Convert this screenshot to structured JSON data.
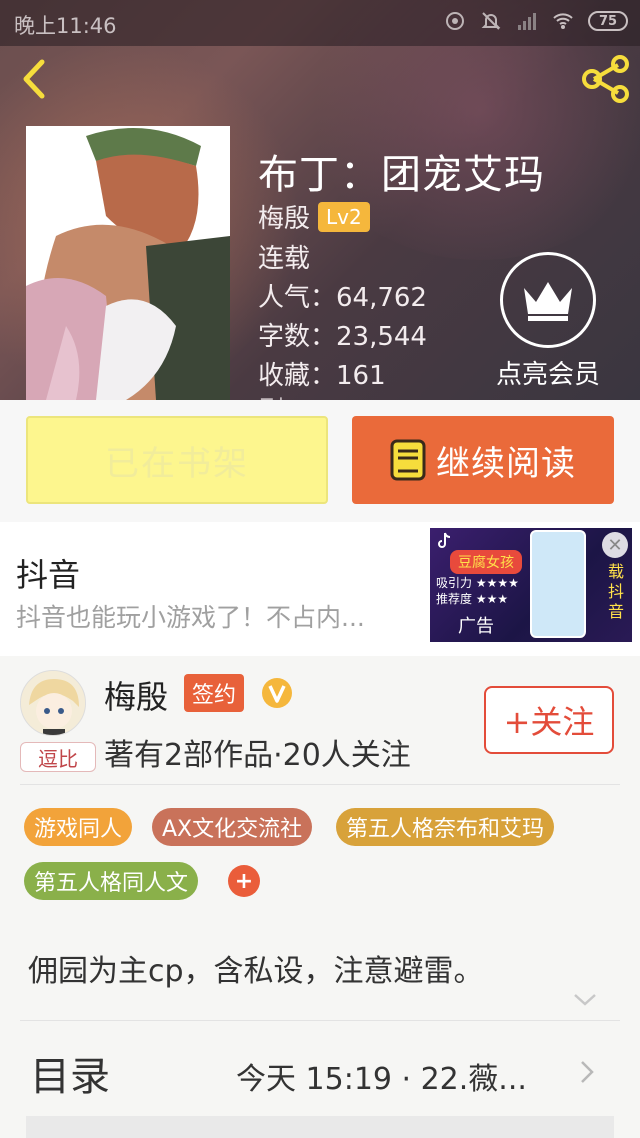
{
  "status_bar": {
    "time": "晚上11:46",
    "battery": "75"
  },
  "book": {
    "title": "布丁：团宠艾玛",
    "author": "梅殷",
    "level": "Lv2",
    "status": "连载",
    "popularity": "人气：64,762",
    "word_count": "字数：23,544",
    "favorites": "收藏：161",
    "partial_line": "剧…"
  },
  "vip": {
    "label": "点亮会员"
  },
  "actions": {
    "shelf_label": "已在书架",
    "read_label": "继续阅读"
  },
  "ad": {
    "title": "抖音",
    "description": "抖音也能玩小游戏了！不占内...",
    "tag": "广告",
    "inner_title": "豆腐女孩",
    "attract": "吸引力 ★★★★",
    "recommend": "推荐度 ★★★",
    "side_text": "载抖音",
    "close": "✕"
  },
  "author_card": {
    "name": "梅殷",
    "badge": "签约",
    "avatar_tag": "逗比",
    "meta": "著有2部作品·20人关注",
    "follow_label": "+关注"
  },
  "tags": [
    {
      "label": "游戏同人",
      "color": "#f2a33a"
    },
    {
      "label": "AX文化交流社",
      "color": "#c9725a"
    },
    {
      "label": "第五人格奈布和艾玛",
      "color": "#d8a23a"
    },
    {
      "label": "第五人格同人文",
      "color": "#8ab04a"
    }
  ],
  "tag_add": "+",
  "description": "佣园为主cp，含私设，注意避雷。",
  "toc": {
    "label": "目录",
    "latest": "今天 15:19 · 22.薇..."
  },
  "colors": {
    "accent_orange": "#ea6a3a",
    "shelf_yellow": "#fdf68e",
    "share_yellow": "#f6dd3c"
  }
}
